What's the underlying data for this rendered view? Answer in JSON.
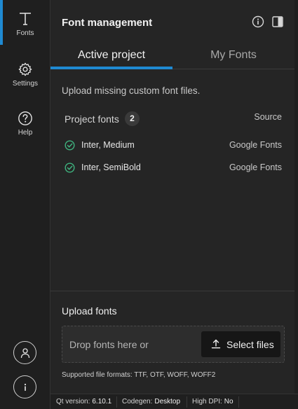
{
  "sidebar": {
    "items": [
      {
        "label": "Fonts",
        "icon": "text-t-icon",
        "active": true
      },
      {
        "label": "Settings",
        "icon": "gear-icon",
        "active": false
      },
      {
        "label": "Help",
        "icon": "question-icon",
        "active": false
      }
    ],
    "bottom": [
      {
        "icon": "user-icon"
      },
      {
        "icon": "info-icon"
      }
    ]
  },
  "panel": {
    "title": "Font management",
    "tabs": [
      {
        "label": "Active project",
        "active": true
      },
      {
        "label": "My Fonts",
        "active": false
      }
    ],
    "description": "Upload missing custom font files.",
    "project_fonts": {
      "label": "Project fonts",
      "count": "2",
      "source_header": "Source",
      "items": [
        {
          "name": "Inter, Medium",
          "source": "Google Fonts"
        },
        {
          "name": "Inter, SemiBold",
          "source": "Google Fonts"
        }
      ]
    },
    "upload": {
      "title": "Upload fonts",
      "drop_text": "Drop fonts here or",
      "select_button": "Select files",
      "formats": "Supported file formats: TTF, OTF, WOFF, WOFF2"
    }
  },
  "statusbar": {
    "qt_label": "Qt version:",
    "qt_value": "6.10.1",
    "codegen_label": "Codegen:",
    "codegen_value": "Desktop",
    "hdpi_label": "High DPI:",
    "hdpi_value": "No"
  },
  "colors": {
    "accent": "#1f8ad2",
    "success": "#3fb37f",
    "background": "#1f1f1f",
    "panel": "#252525"
  }
}
